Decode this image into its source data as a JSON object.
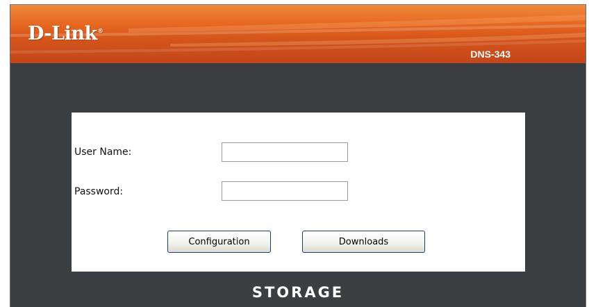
{
  "header": {
    "logo_text": "D-Link",
    "logo_mark": "®",
    "model": "DNS-343"
  },
  "login": {
    "username_label": "User Name:",
    "username_value": "",
    "password_label": "Password:",
    "password_value": "",
    "configuration_button": "Configuration",
    "downloads_button": "Downloads"
  },
  "footer": {
    "brand": "STORAGE"
  },
  "colors": {
    "header_orange": "#e86a22",
    "body_gray": "#3b3f41",
    "panel_white": "#ffffff",
    "button_border": "#1a3d74"
  }
}
